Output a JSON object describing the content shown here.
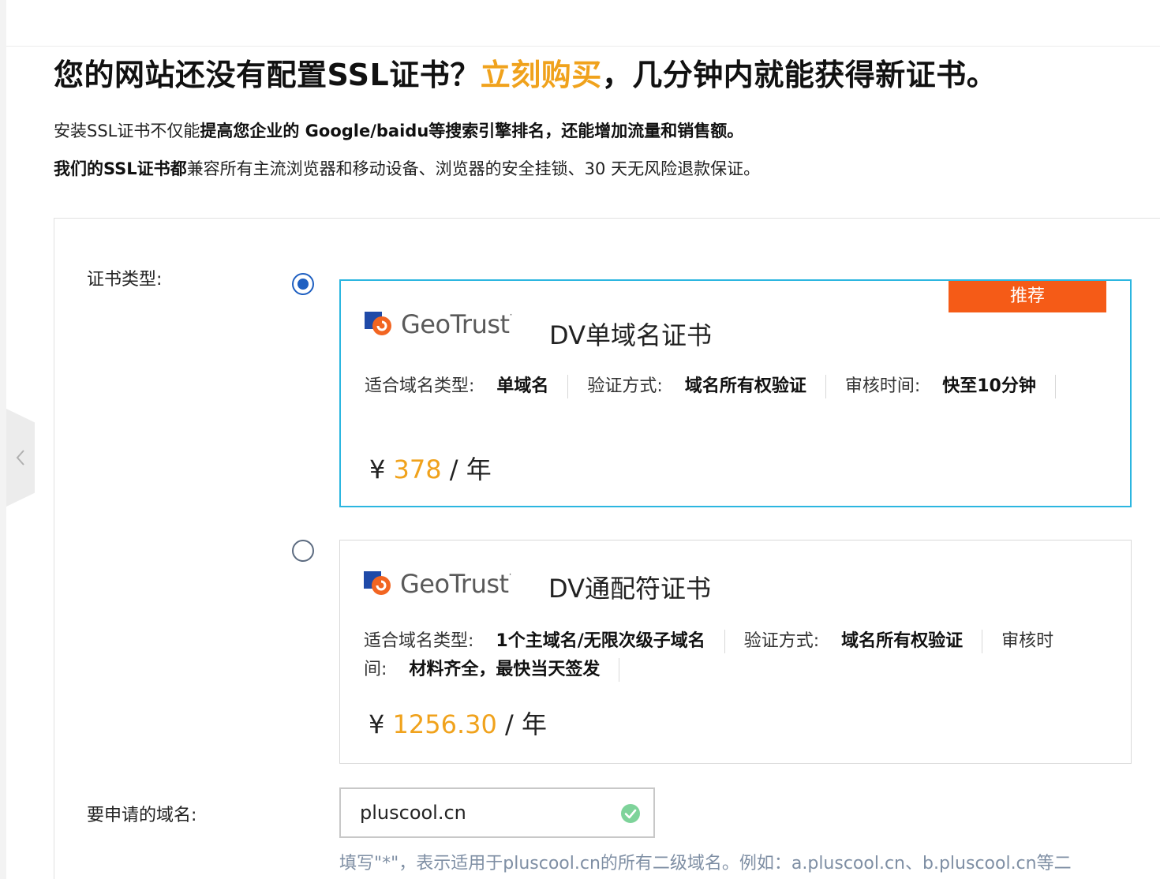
{
  "headline": {
    "prefix": "您的网站还没有配置SSL证书？",
    "buy_link": "立刻购买",
    "suffix": "，几分钟内就能获得新证书。"
  },
  "intro": {
    "line1_a": "安装SSL证书不仅能",
    "line1_b": "提高您企业的 Google/baidu等搜索引擎排名，还能增加流量和销售额。",
    "line2_a": "我们的SSL证书都",
    "line2_b": "兼容所有主流浏览器和移动设备、浏览器的安全挂锁、30 天无风险退款保证。"
  },
  "form": {
    "cert_type_label": "证书类型:",
    "domain_label": "要申请的域名:"
  },
  "cards": [
    {
      "selected": true,
      "badge": "推荐",
      "brand": "GeoTrust",
      "title": "DV单域名证书",
      "domain_type_key": "适合域名类型:",
      "domain_type_value": "单域名",
      "verify_key": "验证方式:",
      "verify_value": "域名所有权验证",
      "review_key": "审核时间:",
      "review_value": "快至10分钟",
      "currency": "¥",
      "amount": "378",
      "per": " / 年"
    },
    {
      "selected": false,
      "brand": "GeoTrust",
      "title": "DV通配符证书",
      "domain_type_key": "适合域名类型:",
      "domain_type_value": "1个主域名/无限次级子域名",
      "verify_key": "验证方式:",
      "verify_value": "域名所有权验证",
      "review_key": "审核时间:",
      "review_value": "材料齐全，最快当天签发",
      "currency": "¥",
      "amount": "1256.30",
      "per": " / 年"
    }
  ],
  "domain_input": {
    "value": "pluscool.cn",
    "status_icon": "check-circle-icon"
  },
  "hint": "填写\"*\"，表示适用于pluscool.cn的所有二级域名。例如：a.pluscool.cn、b.pluscool.cn等二",
  "colors": {
    "accent_orange": "#f0a21c",
    "badge_orange": "#f55b17",
    "selected_border": "#2cb6e0",
    "radio_blue": "#1e5fc1",
    "valid_green": "#7ed39a"
  }
}
